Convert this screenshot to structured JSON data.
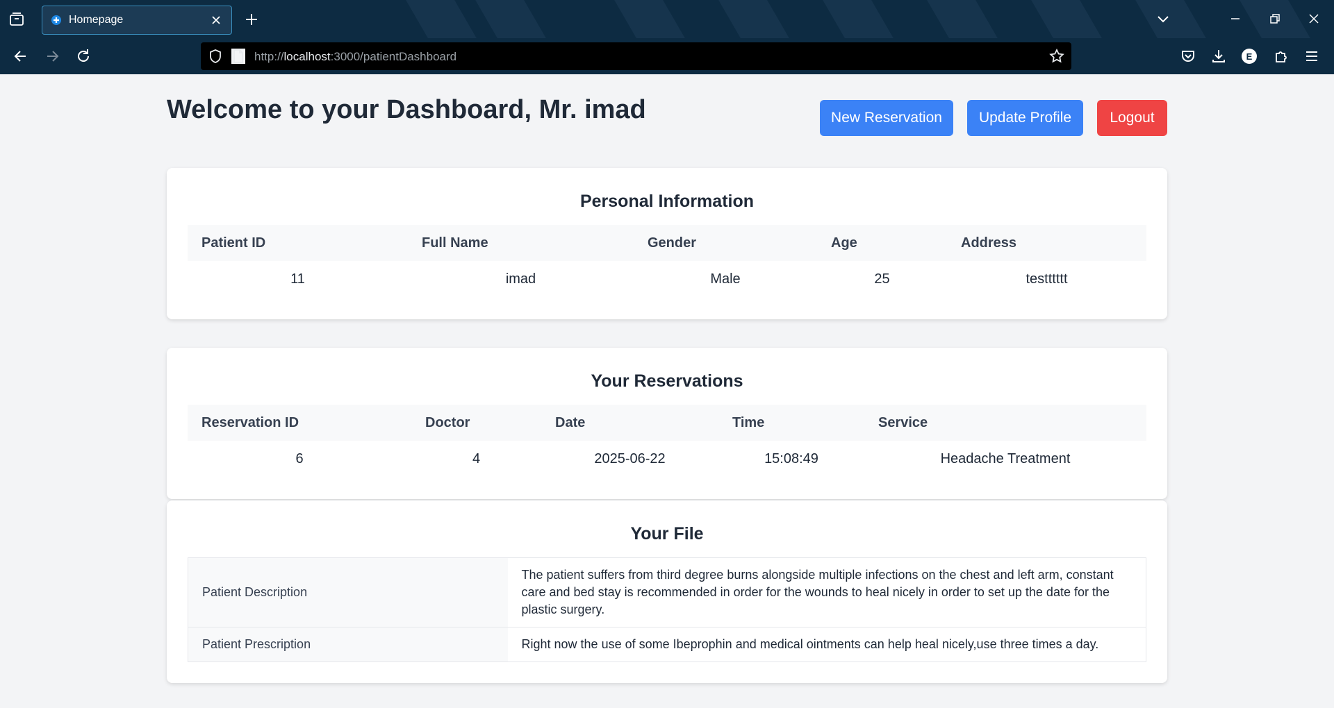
{
  "browser": {
    "tab_title": "Homepage",
    "url_prefix": "http://",
    "url_host": "localhost",
    "url_path": ":3000/patientDashboard",
    "profile_initial": "E"
  },
  "page": {
    "title": "Welcome to your Dashboard, Mr. imad",
    "buttons": {
      "new_reservation": "New Reservation",
      "update_profile": "Update Profile",
      "logout": "Logout"
    },
    "colors": {
      "primary": "#3b82f6",
      "danger": "#ef4444"
    }
  },
  "personal_info": {
    "title": "Personal Information",
    "headers": [
      "Patient ID",
      "Full Name",
      "Gender",
      "Age",
      "Address"
    ],
    "row": [
      "11",
      "imad",
      "Male",
      "25",
      "testttttt"
    ]
  },
  "reservations": {
    "title": "Your Reservations",
    "headers": [
      "Reservation ID",
      "Doctor",
      "Date",
      "Time",
      "Service"
    ],
    "rows": [
      [
        "6",
        "4",
        "2025-06-22",
        "15:08:49",
        "Headache Treatment"
      ]
    ]
  },
  "file": {
    "title": "Your File",
    "rows": [
      {
        "label": "Patient Description",
        "value": "The patient suffers from third degree burns alongside multiple infections on the chest and left arm, constant care and bed stay is recommended in order for the wounds to heal nicely in order to set up the date for the plastic surgery."
      },
      {
        "label": "Patient Prescription",
        "value": "Right now the use of some Ibeprophin and medical ointments can help heal nicely,use three times a day."
      }
    ]
  }
}
